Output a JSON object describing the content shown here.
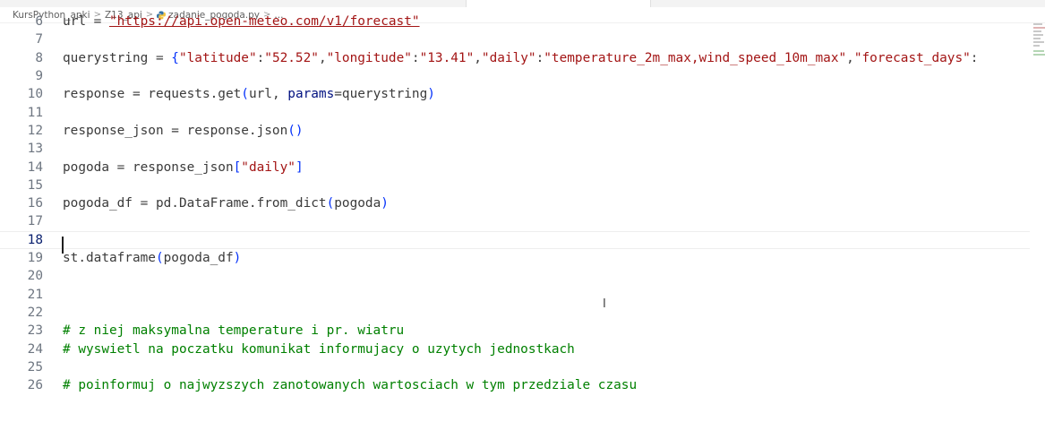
{
  "breadcrumb": {
    "items": [
      "KursPython_apki",
      "Z13_api",
      "zadanie_pogoda.py",
      "..."
    ],
    "separator": ">"
  },
  "editor": {
    "current_line": 18,
    "lines": [
      {
        "num": "6",
        "tokens": [
          {
            "t": "url = ",
            "c": ""
          },
          {
            "t": "\"https://api.open-meteo.com/v1/forecast\"",
            "c": "strlink"
          }
        ]
      },
      {
        "num": "7",
        "tokens": []
      },
      {
        "num": "8",
        "tokens": [
          {
            "t": "querystring = ",
            "c": ""
          },
          {
            "t": "{",
            "c": "br1"
          },
          {
            "t": "\"latitude\"",
            "c": "str"
          },
          {
            "t": ":",
            "c": ""
          },
          {
            "t": "\"52.52\"",
            "c": "str"
          },
          {
            "t": ",",
            "c": ""
          },
          {
            "t": "\"longitude\"",
            "c": "str"
          },
          {
            "t": ":",
            "c": ""
          },
          {
            "t": "\"13.41\"",
            "c": "str"
          },
          {
            "t": ",",
            "c": ""
          },
          {
            "t": "\"daily\"",
            "c": "str"
          },
          {
            "t": ":",
            "c": ""
          },
          {
            "t": "\"temperature_2m_max,wind_speed_10m_max\"",
            "c": "str"
          },
          {
            "t": ",",
            "c": ""
          },
          {
            "t": "\"forecast_days\"",
            "c": "str"
          },
          {
            "t": ":",
            "c": ""
          }
        ]
      },
      {
        "num": "9",
        "tokens": []
      },
      {
        "num": "10",
        "tokens": [
          {
            "t": "response = requests.get",
            "c": ""
          },
          {
            "t": "(",
            "c": "br1"
          },
          {
            "t": "url, ",
            "c": ""
          },
          {
            "t": "params",
            "c": "kw"
          },
          {
            "t": "=querystring",
            "c": ""
          },
          {
            "t": ")",
            "c": "br1"
          }
        ]
      },
      {
        "num": "11",
        "tokens": []
      },
      {
        "num": "12",
        "tokens": [
          {
            "t": "response_json = response.json",
            "c": ""
          },
          {
            "t": "()",
            "c": "br1"
          }
        ]
      },
      {
        "num": "13",
        "tokens": []
      },
      {
        "num": "14",
        "tokens": [
          {
            "t": "pogoda = response_json",
            "c": ""
          },
          {
            "t": "[",
            "c": "br1"
          },
          {
            "t": "\"daily\"",
            "c": "str"
          },
          {
            "t": "]",
            "c": "br1"
          }
        ]
      },
      {
        "num": "15",
        "tokens": []
      },
      {
        "num": "16",
        "tokens": [
          {
            "t": "pogoda_df = pd.DataFrame.from_dict",
            "c": ""
          },
          {
            "t": "(",
            "c": "br1"
          },
          {
            "t": "pogoda",
            "c": ""
          },
          {
            "t": ")",
            "c": "br1"
          }
        ]
      },
      {
        "num": "17",
        "tokens": []
      },
      {
        "num": "18",
        "tokens": []
      },
      {
        "num": "19",
        "tokens": [
          {
            "t": "st.dataframe",
            "c": ""
          },
          {
            "t": "(",
            "c": "br1"
          },
          {
            "t": "pogoda_df",
            "c": ""
          },
          {
            "t": ")",
            "c": "br1"
          }
        ]
      },
      {
        "num": "20",
        "tokens": []
      },
      {
        "num": "21",
        "tokens": []
      },
      {
        "num": "22",
        "tokens": []
      },
      {
        "num": "23",
        "tokens": [
          {
            "t": "# z niej maksymalna temperature i pr. wiatru",
            "c": "cm"
          }
        ]
      },
      {
        "num": "24",
        "tokens": [
          {
            "t": "# wyswietl na poczatku komunikat informujacy o uzytych jednostkach",
            "c": "cm"
          }
        ]
      },
      {
        "num": "25",
        "tokens": []
      },
      {
        "num": "26",
        "tokens": [
          {
            "t": "# poinformuj o najwyzszych zanotowanych wartosciach w tym przedziale czasu",
            "c": "cm"
          }
        ]
      }
    ]
  },
  "icons": {
    "python_file": "python-file-icon",
    "mouse_cursor": "ibeam-cursor-icon"
  },
  "colors": {
    "string": "#a31515",
    "comment": "#008000",
    "parameter": "#001080",
    "bracket": "#0431fa",
    "text": "#3b3b3b",
    "line_number": "#6e7681"
  }
}
